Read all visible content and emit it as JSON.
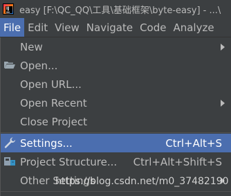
{
  "window": {
    "title": "easy [F:\\QC_QQ\\工具\\基础框架\\byte-easy] - ...\\"
  },
  "menubar": {
    "items": [
      {
        "label": "File",
        "active": true
      },
      {
        "label": "Edit"
      },
      {
        "label": "View"
      },
      {
        "label": "Navigate"
      },
      {
        "label": "Code"
      },
      {
        "label": "Analyze"
      }
    ]
  },
  "file_menu": {
    "items": [
      {
        "label": "New",
        "submenu": true
      },
      {
        "label": "Open...",
        "icon": "folder-open-icon"
      },
      {
        "label": "Open URL..."
      },
      {
        "label": "Open Recent",
        "submenu": true
      },
      {
        "label": "Close Project"
      },
      {
        "label": "Settings...",
        "shortcut": "Ctrl+Alt+S",
        "icon": "wrench-icon",
        "selected": true
      },
      {
        "label": "Project Structure...",
        "shortcut": "Ctrl+Alt+Shift+S",
        "icon": "project-structure-icon"
      },
      {
        "label": "Other Settings",
        "submenu": true
      }
    ]
  },
  "watermark": "https://blog.csdn.net/m0_37482190",
  "colors": {
    "background": "#3c3f41",
    "selection": "#4b6eaf",
    "text": "#bbbbbb"
  }
}
